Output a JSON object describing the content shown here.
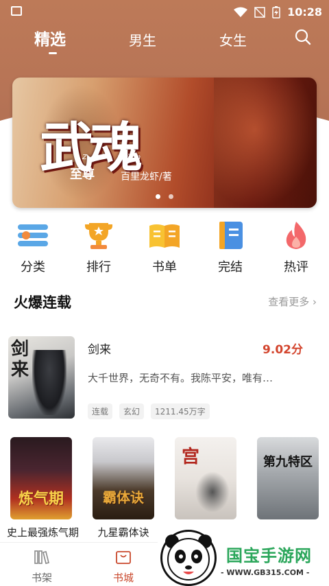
{
  "status_bar": {
    "time": "10:28"
  },
  "tabs": [
    {
      "label": "精选",
      "active": true
    },
    {
      "label": "男生",
      "active": false
    },
    {
      "label": "女生",
      "active": false
    }
  ],
  "banner": {
    "title": "武魂",
    "pinyin": "Zhì zūn",
    "subtitle": "至尊",
    "author": "百里龙虾/著",
    "page_count": 2,
    "active_page": 1
  },
  "quick_entries": [
    {
      "label": "分类",
      "icon": "category-icon"
    },
    {
      "label": "排行",
      "icon": "trophy-icon"
    },
    {
      "label": "书单",
      "icon": "book-list-icon"
    },
    {
      "label": "完结",
      "icon": "finished-book-icon"
    },
    {
      "label": "热评",
      "icon": "flame-icon"
    }
  ],
  "section": {
    "title": "火爆连载",
    "more": "查看更多 ›"
  },
  "featured_book": {
    "cover_text": "剑来",
    "title": "剑来",
    "score": "9.02分",
    "desc": "大千世界，无奇不有。我陈平安，唯有…",
    "tags": [
      "连载",
      "玄幻",
      "1211.45万字"
    ]
  },
  "books": [
    {
      "title": "史上最强炼气期",
      "cover_text": "炼气期"
    },
    {
      "title": "九星霸体诀",
      "cover_text": "霸体诀"
    },
    {
      "title": "",
      "cover_text": "宫"
    },
    {
      "title": "",
      "cover_text": "第九特区"
    }
  ],
  "bottom_tabs": [
    {
      "label": "书架",
      "icon": "bookshelf-icon",
      "active": false
    },
    {
      "label": "书城",
      "icon": "bookstore-icon",
      "active": true
    }
  ],
  "watermark": {
    "text": "国宝手游网",
    "url": "- WWW.GB315.COM -"
  },
  "colors": {
    "accent": "#c9482c",
    "header": "#b77456",
    "score": "#d3452e"
  }
}
